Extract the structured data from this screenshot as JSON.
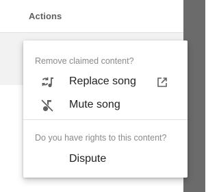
{
  "header": {
    "actions_label": "Actions"
  },
  "menu": {
    "remove_heading": "Remove claimed content?",
    "items": [
      {
        "label": "Replace song",
        "icon": "replace-song-icon",
        "trailing_icon": "open-external-icon"
      },
      {
        "label": "Mute song",
        "icon": "mute-song-icon"
      }
    ],
    "rights_heading": "Do you have rights to this content?",
    "dispute_label": "Dispute"
  },
  "colors": {
    "overlay": "#6b6b6b",
    "row_highlight": "#f2f2f2",
    "menu_background": "#ffffff",
    "heading_text": "#8a8a8a",
    "item_text": "#212121"
  }
}
